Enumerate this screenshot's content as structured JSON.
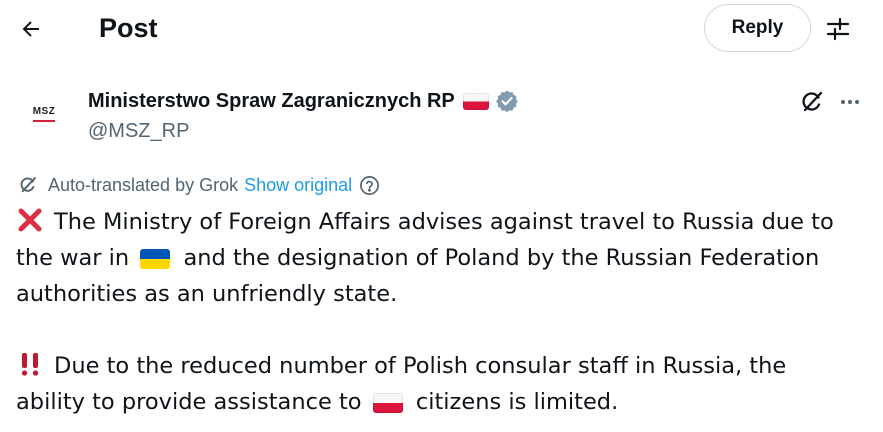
{
  "header": {
    "title": "Post",
    "reply_label": "Reply"
  },
  "icons": {
    "back": "arrow-left-icon",
    "settings": "sliders-icon",
    "verified": "verified-badge-icon",
    "grok": "grok-icon",
    "more": "more-dots-icon",
    "help": "question-circle-icon"
  },
  "author": {
    "avatar_text": "MSZ",
    "name": "Ministerstwo Spraw Zagranicznych RP",
    "handle": "@MSZ_RP"
  },
  "translation": {
    "label": "Auto-translated by Grok",
    "show_original": "Show original"
  },
  "tweet": {
    "p1_line1": "The Ministry of Foreign Affairs advises against travel to Russia due to",
    "p1_line2_a": "the war in",
    "p1_line2_b": "and the designation of Poland by the Russian Federation",
    "p1_line3": "authorities as an unfriendly state.",
    "p2_line1": "Due to the reduced number of Polish consular staff in Russia, the",
    "p2_line2_a": "ability to provide assistance to",
    "p2_line2_b": "citizens is limited."
  },
  "colors": {
    "text": "#0f1419",
    "secondary": "#536471",
    "link": "#1d9bf0",
    "verified": "#829aab",
    "border": "#cfd9de"
  }
}
